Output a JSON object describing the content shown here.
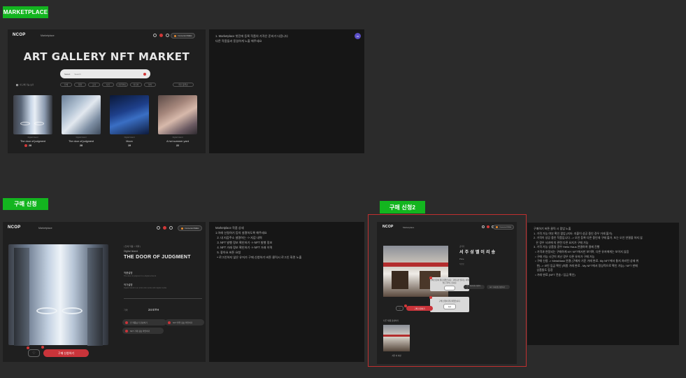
{
  "sections": {
    "marketplace": "MARKETPLACE",
    "purchase": "구매 신청",
    "purchase2": "구매 신청2"
  },
  "header": {
    "logo": "NCOP",
    "nav_marketplace": "Marketplace",
    "wallet": "Connected Wallet"
  },
  "marketplace": {
    "title": "ART GALLERY NFT MARKET",
    "search_select": "Select",
    "search_placeholder": "Search",
    "filter_label": "내 구매 가능 보기",
    "categories": [
      "전체",
      "회화",
      "조각",
      "사진",
      "디지털아트",
      "미디어",
      "설치"
    ],
    "sort": "최신 등록순",
    "cards": [
      {
        "subtitle": "Digital Island",
        "title": "The door of judgment",
        "price": "28"
      },
      {
        "subtitle": "Digital Island",
        "title": "The door of judgment",
        "price": "28"
      },
      {
        "subtitle": "Digital Island",
        "title": "Moon",
        "price": "19"
      },
      {
        "subtitle": "Digital Island",
        "title": "A hot summer yard",
        "price": "22"
      }
    ],
    "notes": [
      "1. Marketplace 첫진에 등록 작품의 가격은 준비가 다음니다",
      "",
      "다른 작품들과 동일하게 노출 해주세요"
    ],
    "note_badge": "01"
  },
  "purchase": {
    "breadcrumb": "[ 전체 작품 > 회화 ]",
    "artist": "Digital Island",
    "title": "THE DOOR OF JUDGMENT",
    "label_desc": "작품설명",
    "desc": "The door of judgment is a digital artwork",
    "label_info": "작가설명",
    "info": "Digital Island is an artist who works with digital media",
    "price_label": "가격",
    "price": "24 ETH",
    "chips": [
      "전 작품보기 감상하기",
      "NFT 발행 정보 확인하기",
      "NFT 거래 정보 확인하기"
    ],
    "buy_button": "구매 신청하기",
    "notes": [
      "Marketplace 작품 상세",
      "",
      "1.아래 신청하기 등의 설명하도록 해주세요",
      "  2. 내 지갑주소 설명하는 -> 지갑 내역",
      "  3. NFT 발행 정보 확인하기 -> NFT 발행 정보",
      "  4. NFT 거래 정보 확인하기 -> NFT 거래 이력",
      "  5. 좋아요 버튼 요청",
      "",
      "  • 로그인하지 않은 유저가 구매 신청하기 버튼 클릭시 로그인 화면 노출"
    ]
  },
  "purchase2": {
    "logo": "NCOP",
    "artist": "공작가",
    "title": "서 주 성 벨 이 리 송",
    "price_label": "Price",
    "meta": "작품명",
    "dialog1": "구매 신청이 완료되었습니다. 구매 승인 결과는 이메일로 알려드립니다.",
    "dialog2": "구매 신청이 완료되었습니다.",
    "dialog_ok": "확인",
    "chips": [
      "NFT 발행 정보 확인하기",
      "NFT 거래 정보 확인하기"
    ],
    "buy_button": "구매 신청하기",
    "other_label": "다른 작품 감상하기",
    "other_title": "서촌 이 이상",
    "notes": [
      "구매하기 버튼 클릭 시 팝업 노출",
      "",
      "1. 가격 가능 여부 확인 팝업 (지터: 지불이 성공 중인 경우 거래 불가)",
      "2. 가격이 성공 중인 작품입니다. -> 오인 등록 다른 중인데 구매 불가, 또는 오인 연결을 하지 않",
      "   은 경우 사과에 의 관련 다른 요지가 구매 가능",
      "3. 가격 가능 상품일 경우 Hello Haus 연결하여 결제 진행",
      "",
      "  • 가격과 연동되는 구매하게 MY NFT에서만 보이며, 다른 유저에게는 보이지 않음",
      "  • 구매 가능 시간이 지난 경우 다른 유저가 구매 가능",
      "",
      "  • 구매 신청 -> MetaMask 연결 (구매자 기준 거래 완료- My NFT에서 통지 처리된 상태 위",
      "    한) -> 코인 입금 확인 (최종 거래 완료 - My NFT에서 정상적으로 확인 가능) / NFT 판매",
      "    상품들도 등장",
      "  • 거래 완료 (NFT 전송 / 입금 확인)"
    ]
  }
}
